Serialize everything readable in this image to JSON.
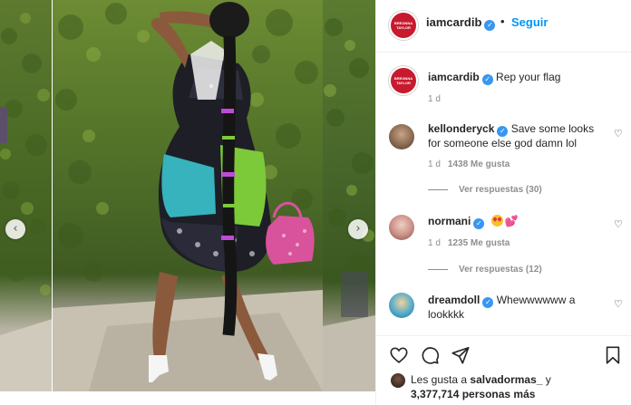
{
  "post": {
    "author": {
      "username": "iamcardib",
      "verified": true,
      "avatar_text": [
        "BREONNA",
        "TAYLOR"
      ],
      "follow_label": "Seguir",
      "separator": "•"
    },
    "caption": {
      "username": "iamcardib",
      "text": "Rep your flag",
      "time": "1 d"
    },
    "carousel": {
      "prev_arrow": "‹",
      "next_arrow": "›"
    },
    "comments": [
      {
        "username": "kellonderyck",
        "verified": true,
        "text": "Save some looks for someone else god damn lol",
        "time": "1 d",
        "likes": "1438 Me gusta",
        "replies": "Ver respuestas (30)",
        "avatar_color": "#8a6a50"
      },
      {
        "username": "normani",
        "verified": true,
        "text": "",
        "emoji": [
          "heart-eyes-emoji",
          "sparkling-heart-emoji"
        ],
        "time": "1 d",
        "likes": "1235 Me gusta",
        "replies": "Ver respuestas (12)",
        "avatar_color": "#c98e86"
      },
      {
        "username": "dreamdoll",
        "verified": true,
        "text": "Whewwwwww a lookkkk",
        "avatar_color": "#4aa7c9"
      }
    ],
    "likes_summary": {
      "prefix": "Les gusta a",
      "liker": "salvadormas_",
      "joiner": "y",
      "count": "3,377,714 personas más"
    },
    "icons": {
      "like": "heart-icon",
      "comment": "comment-icon",
      "share": "share-icon",
      "save": "bookmark-icon",
      "comment_like": "♡"
    },
    "colors": {
      "accent": "#0095f6",
      "verified": "#3897f0",
      "muted": "#8e8e8e",
      "brand_avatar": "#c81a2e"
    }
  }
}
